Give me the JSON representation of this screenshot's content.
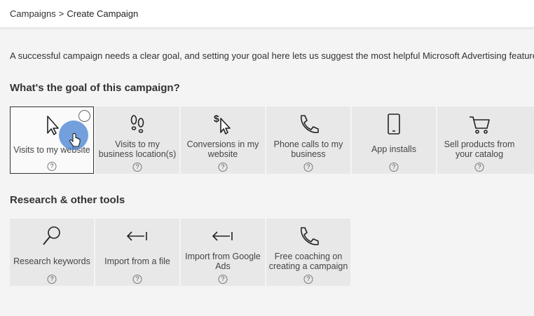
{
  "breadcrumb": {
    "root": "Campaigns",
    "separator": ">",
    "current": "Create Campaign"
  },
  "intro_text": "A successful campaign needs a clear goal, and setting your goal here lets us suggest the most helpful Microsoft Advertising features for your c",
  "goal_section": {
    "title": "What's the goal of this campaign?",
    "tiles": [
      {
        "label": "Visits to my website",
        "icon": "cursor-arrow-icon",
        "selected": true
      },
      {
        "label": "Visits to my business location(s)",
        "icon": "footprints-icon",
        "selected": false
      },
      {
        "label": "Conversions in my website",
        "icon": "dollar-cursor-icon",
        "selected": false
      },
      {
        "label": "Phone calls to my business",
        "icon": "phone-icon",
        "selected": false
      },
      {
        "label": "App installs",
        "icon": "mobile-device-icon",
        "selected": false
      },
      {
        "label": "Sell products from your catalog",
        "icon": "shopping-cart-icon",
        "selected": false
      }
    ]
  },
  "tools_section": {
    "title": "Research & other tools",
    "tiles": [
      {
        "label": "Research keywords",
        "icon": "search-icon"
      },
      {
        "label": "Import from a file",
        "icon": "import-arrow-icon"
      },
      {
        "label": "Import from Google Ads",
        "icon": "import-arrow-icon"
      },
      {
        "label": "Free coaching on creating a campaign",
        "icon": "phone-icon"
      }
    ]
  },
  "help_glyph": "?",
  "colors": {
    "tile_bg": "#e8e8e8",
    "selected_border": "#333333",
    "cursor_highlight": "#4682d2"
  }
}
